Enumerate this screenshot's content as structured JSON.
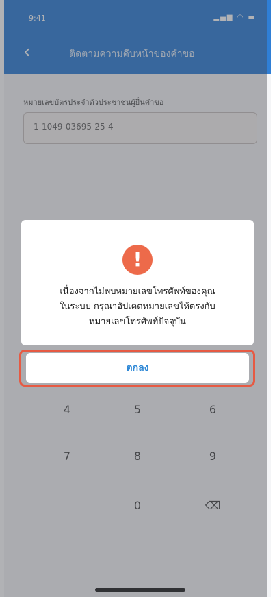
{
  "status_bar": {
    "time": "9:41",
    "icons": "▂▄▆ ◠ ▬"
  },
  "header": {
    "title": "ติดตามความคืบหน้าของคำขอ",
    "back_icon": "chevron-left-icon"
  },
  "form": {
    "field_label": "หมายเลขบัตรประจำตัวประชาชนผู้ยื่นคำขอ",
    "id_value": "1-1049-03695-25-4"
  },
  "keypad": {
    "keys": [
      "4",
      "5",
      "6",
      "7",
      "8",
      "9",
      "0"
    ],
    "delete_icon": "backspace-icon"
  },
  "dialog": {
    "icon": "alert-icon",
    "icon_glyph": "!",
    "icon_color": "#ed6a4a",
    "message_lines": [
      "เนื่องจากไม่พบหมายเลขโทรศัพท์ของคุณ",
      "ในระบบ กรุณาอัปเดตหมายเลขให้ตรงกับ",
      "หมายเลขโทรศัพท์ปัจจุบัน"
    ],
    "ok_label": "ตกลง",
    "ok_color": "#2e88d6",
    "highlight_color": "#e65a43"
  }
}
